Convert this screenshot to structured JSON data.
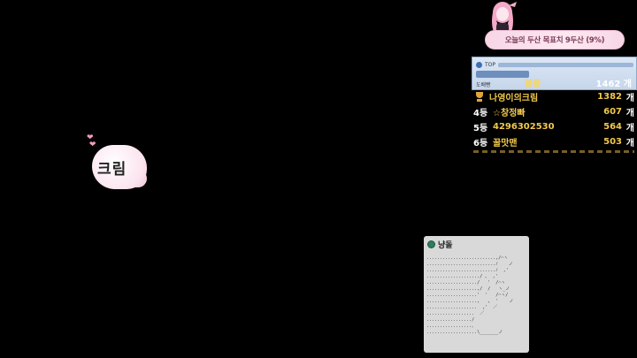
{
  "goal": {
    "text": "오늘의 두산 목표치 9두산 (9%)"
  },
  "ranking": {
    "header_label": "TOP",
    "header_sub": "도배빵",
    "first": {
      "name": "불불",
      "count": "1462 개"
    },
    "rows": [
      {
        "pos": "",
        "name": "나영이의크림",
        "count": "1382",
        "unit": "개"
      },
      {
        "pos": "4등",
        "name": "☆창정빠",
        "count": "607",
        "unit": "개"
      },
      {
        "pos": "5등",
        "name": "4296302530",
        "count": "564",
        "unit": "개"
      },
      {
        "pos": "6등",
        "name": "꿀맛맨",
        "count": "503",
        "unit": "개"
      }
    ]
  },
  "bubble": {
    "text": "크림",
    "hearts": "❤\n ❤"
  },
  "chat": {
    "username": "냥돌",
    "art": "                         \n..........................,/⌒ヽ\n..........................ﾉ    ノ\n..........................ﾉ  ,'\n..................../ ､  ,'\n.................../   '  /⌒ヽ\n...................,/  /   ヽ_ノ\n...................'  '   /⌒ヽ/\n...................,   ,  '    ノ\n...................  ,'  ／\n..................  ／\n................./\n.................、\n...................\\_______ノ"
  }
}
